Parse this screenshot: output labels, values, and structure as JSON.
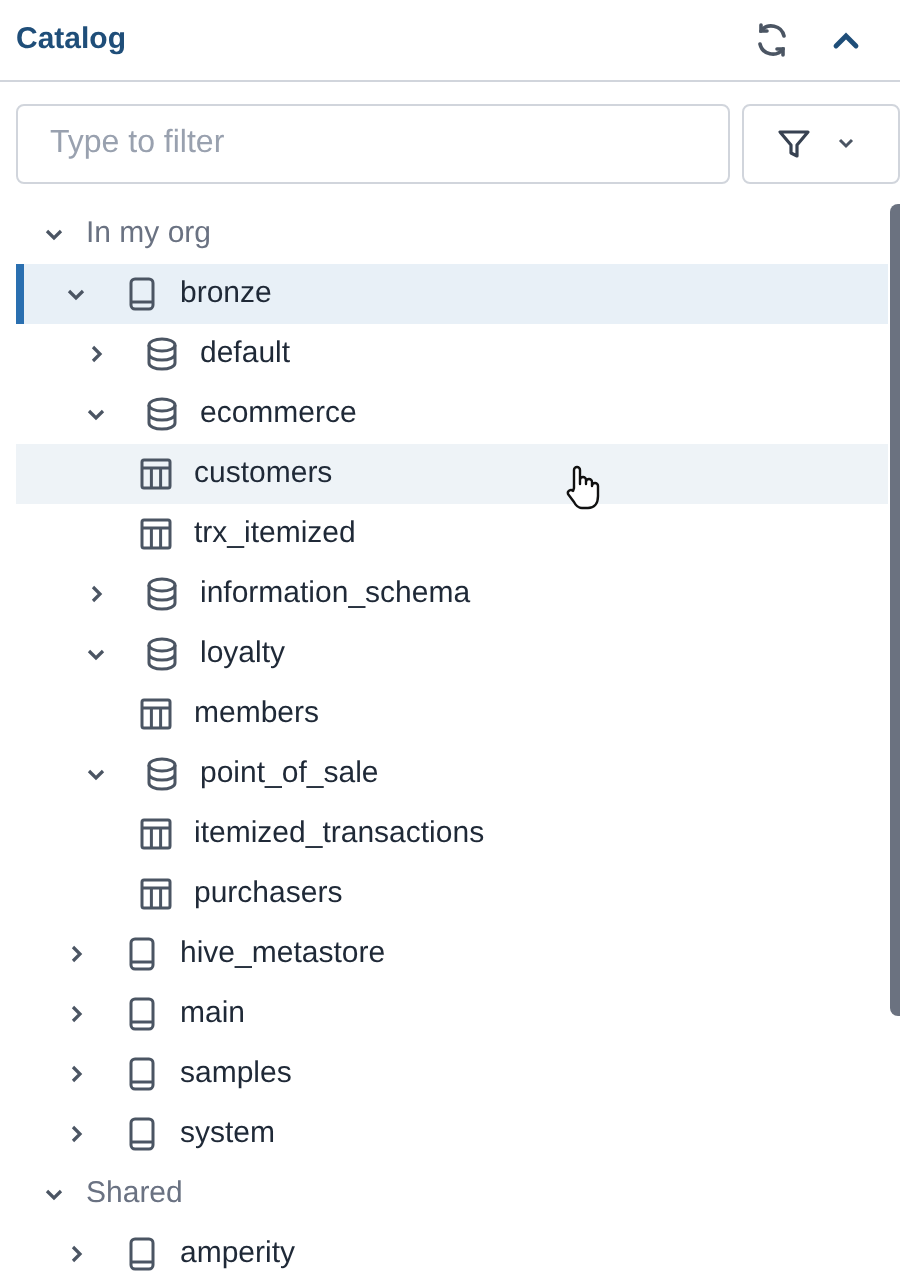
{
  "panel": {
    "title": "Catalog"
  },
  "filter": {
    "placeholder": "Type to filter"
  },
  "sections": [
    {
      "label": "In my org",
      "expanded": true,
      "children": [
        {
          "name": "bronze",
          "kind": "catalog",
          "expanded": true,
          "selected": true,
          "hovered": false,
          "children": [
            {
              "name": "default",
              "kind": "schema",
              "expanded": false,
              "selected": false,
              "hovered": false
            },
            {
              "name": "ecommerce",
              "kind": "schema",
              "expanded": true,
              "selected": false,
              "hovered": false,
              "children": [
                {
                  "name": "customers",
                  "kind": "table",
                  "selected": false,
                  "hovered": true
                },
                {
                  "name": "trx_itemized",
                  "kind": "table",
                  "selected": false,
                  "hovered": false
                }
              ]
            },
            {
              "name": "information_schema",
              "kind": "schema",
              "expanded": false,
              "selected": false,
              "hovered": false
            },
            {
              "name": "loyalty",
              "kind": "schema",
              "expanded": true,
              "selected": false,
              "hovered": false,
              "children": [
                {
                  "name": "members",
                  "kind": "table",
                  "selected": false,
                  "hovered": false
                }
              ]
            },
            {
              "name": "point_of_sale",
              "kind": "schema",
              "expanded": true,
              "selected": false,
              "hovered": false,
              "children": [
                {
                  "name": "itemized_transactions",
                  "kind": "table",
                  "selected": false,
                  "hovered": false
                },
                {
                  "name": "purchasers",
                  "kind": "table",
                  "selected": false,
                  "hovered": false
                }
              ]
            }
          ]
        },
        {
          "name": "hive_metastore",
          "kind": "catalog",
          "expanded": false,
          "selected": false,
          "hovered": false
        },
        {
          "name": "main",
          "kind": "catalog",
          "expanded": false,
          "selected": false,
          "hovered": false
        },
        {
          "name": "samples",
          "kind": "catalog",
          "expanded": false,
          "selected": false,
          "hovered": false
        },
        {
          "name": "system",
          "kind": "catalog",
          "expanded": false,
          "selected": false,
          "hovered": false
        }
      ]
    },
    {
      "label": "Shared",
      "expanded": true,
      "children": [
        {
          "name": "amperity",
          "kind": "catalog",
          "expanded": false,
          "selected": false,
          "hovered": false
        }
      ]
    }
  ]
}
